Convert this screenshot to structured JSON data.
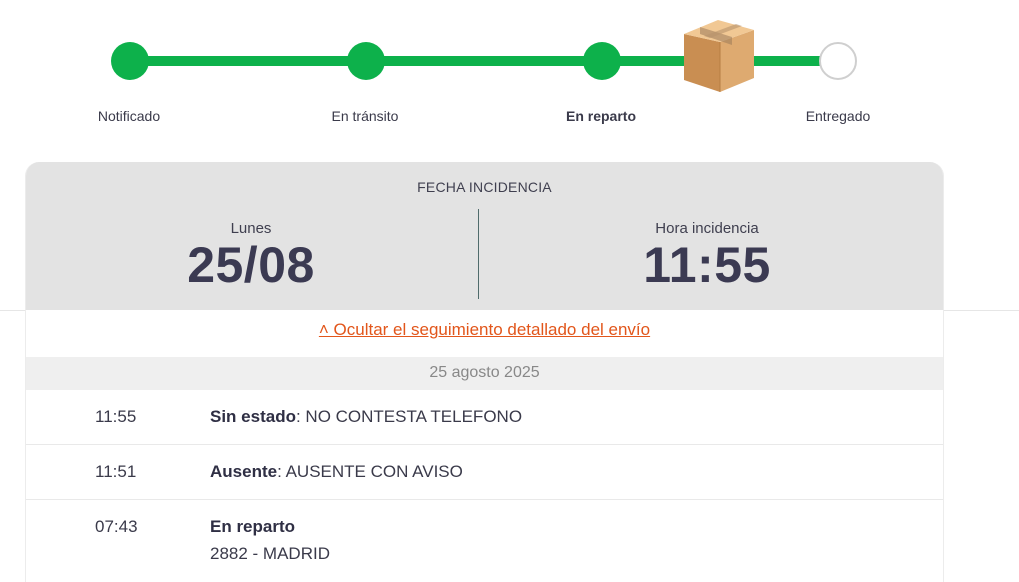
{
  "tracker": {
    "steps": [
      {
        "label": "Notificado",
        "state": "done"
      },
      {
        "label": "En tránsito",
        "state": "done"
      },
      {
        "label": "En reparto",
        "state": "current"
      },
      {
        "label": "Entregado",
        "state": "pending"
      }
    ],
    "current_icon": "package-box-icon",
    "accent_color": "#0db14b"
  },
  "incident": {
    "title": "FECHA INCIDENCIA",
    "day_label": "Lunes",
    "date": "25/08",
    "time_label": "Hora incidencia",
    "time": "11:55"
  },
  "details": {
    "toggle_label": "˄ Ocultar el seguimiento detallado del envío",
    "link_color": "#e2561b",
    "date_header": "25 agosto 2025",
    "events": [
      {
        "time": "11:55",
        "status": "Sin estado",
        "detail": ": NO CONTESTA TELEFONO",
        "sub": ""
      },
      {
        "time": "11:51",
        "status": "Ausente",
        "detail": ": AUSENTE CON AVISO",
        "sub": ""
      },
      {
        "time": "07:43",
        "status": "En reparto",
        "detail": "",
        "sub": "2882 - MADRID"
      }
    ]
  }
}
